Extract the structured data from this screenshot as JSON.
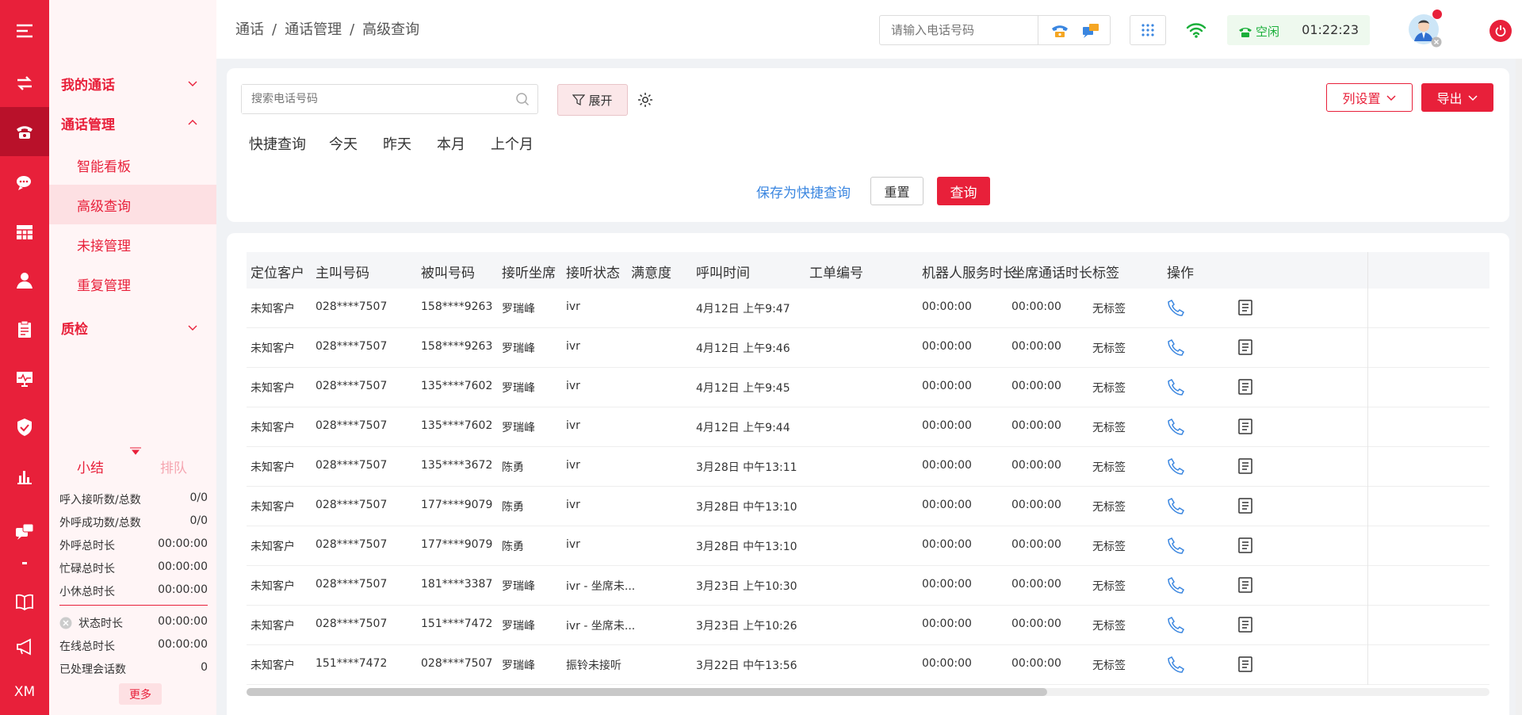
{
  "colors": {
    "brand": "#e8203a",
    "link": "#3a86e0",
    "idle": "#1aaf3a"
  },
  "rail": {
    "icons": [
      "menu-icon",
      "transfer-icon",
      "phone-icon",
      "chat-icon",
      "table-icon",
      "user-icon",
      "clipboard-icon",
      "monitor-icon",
      "shield-icon",
      "bar-chart-icon",
      "messages-icon",
      "book-icon",
      "megaphone-icon"
    ],
    "brand_text": "XM"
  },
  "menu": {
    "my_calls": "我的通话",
    "call_management": "通话管理",
    "sub_items": [
      "智能看板",
      "高级查询",
      "未接管理",
      "重复管理"
    ],
    "quality": "质检"
  },
  "stats": {
    "tab_summary": "小结",
    "tab_queue": "排队",
    "rows_top": [
      {
        "k": "呼入接听数/总数",
        "v": "0/0"
      },
      {
        "k": "外呼成功数/总数",
        "v": "0/0"
      },
      {
        "k": "外呼总时长",
        "v": "00:00:00"
      },
      {
        "k": "忙碌总时长",
        "v": "00:00:00"
      },
      {
        "k": "小休总时长",
        "v": "00:00:00"
      }
    ],
    "rows_bottom": [
      {
        "k": "状态时长",
        "v": "00:00:00"
      },
      {
        "k": "在线总时长",
        "v": "00:00:00"
      },
      {
        "k": "已处理会话数",
        "v": "0"
      }
    ],
    "more": "更多"
  },
  "header": {
    "crumbs": [
      "通话",
      "通话管理",
      "高级查询"
    ],
    "phone_placeholder": "请输入电话号码",
    "status": "空闲",
    "timer": "01:22:23"
  },
  "filter": {
    "search_placeholder": "搜索电话号码",
    "expand": "展开",
    "column_settings": "列设置",
    "export": "导出",
    "quick_label": "快捷查询",
    "quick_items": [
      "今天",
      "昨天",
      "本月",
      "上个月"
    ],
    "save_quick": "保存为快捷查询",
    "reset": "重置",
    "query": "查询"
  },
  "table": {
    "headers": [
      "定位客户",
      "主叫号码",
      "被叫号码",
      "接听坐席",
      "接听状态",
      "满意度",
      "呼叫时间",
      "工单编号",
      "机器人服务时长",
      "坐席通话时长",
      "标签",
      "操作"
    ],
    "rows": [
      [
        "未知客户",
        "028****7507",
        "158****9263",
        "罗瑞峰",
        "ivr",
        "",
        "4月12日 上午9:47",
        "",
        "00:00:00",
        "00:00:00",
        "无标签"
      ],
      [
        "未知客户",
        "028****7507",
        "158****9263",
        "罗瑞峰",
        "ivr",
        "",
        "4月12日 上午9:46",
        "",
        "00:00:00",
        "00:00:00",
        "无标签"
      ],
      [
        "未知客户",
        "028****7507",
        "135****7602",
        "罗瑞峰",
        "ivr",
        "",
        "4月12日 上午9:45",
        "",
        "00:00:00",
        "00:00:00",
        "无标签"
      ],
      [
        "未知客户",
        "028****7507",
        "135****7602",
        "罗瑞峰",
        "ivr",
        "",
        "4月12日 上午9:44",
        "",
        "00:00:00",
        "00:00:00",
        "无标签"
      ],
      [
        "未知客户",
        "028****7507",
        "135****3672",
        "陈勇",
        "ivr",
        "",
        "3月28日 中午13:11",
        "",
        "00:00:00",
        "00:00:00",
        "无标签"
      ],
      [
        "未知客户",
        "028****7507",
        "177****9079",
        "陈勇",
        "ivr",
        "",
        "3月28日 中午13:10",
        "",
        "00:00:00",
        "00:00:00",
        "无标签"
      ],
      [
        "未知客户",
        "028****7507",
        "177****9079",
        "陈勇",
        "ivr",
        "",
        "3月28日 中午13:10",
        "",
        "00:00:00",
        "00:00:00",
        "无标签"
      ],
      [
        "未知客户",
        "028****7507",
        "181****3387",
        "罗瑞峰",
        "ivr - 坐席未...",
        "",
        "3月23日 上午10:30",
        "",
        "00:00:00",
        "00:00:00",
        "无标签"
      ],
      [
        "未知客户",
        "028****7507",
        "151****7472",
        "罗瑞峰",
        "ivr - 坐席未...",
        "",
        "3月23日 上午10:26",
        "",
        "00:00:00",
        "00:00:00",
        "无标签"
      ],
      [
        "未知客户",
        "151****7472",
        "028****7507",
        "罗瑞峰",
        "振铃未接听",
        "",
        "3月22日 中午13:56",
        "",
        "00:00:00",
        "00:00:00",
        "无标签"
      ]
    ]
  }
}
